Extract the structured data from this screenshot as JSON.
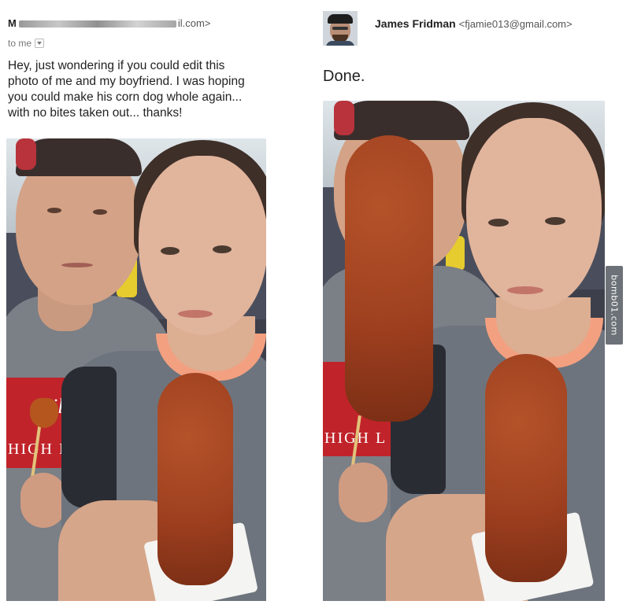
{
  "request_email": {
    "sender_initial": "M",
    "sender_suffix": "il.com>",
    "recipient": "to me",
    "body": "Hey, just wondering if you could edit this\nphoto of me and my boyfriend. I was hoping\nyou could make his corn dog whole again...\nwith no bites taken out... thanks!"
  },
  "reply_email": {
    "sender_name": "James Fridman",
    "sender_email": "<fjamie013@gmail.com>",
    "body": "Done."
  },
  "shirt_text": {
    "brand_fragment": "ill",
    "slogan_fragment_left": "HIGH L",
    "slogan_fragment_right": "HIGH L"
  },
  "watermark": "bomb01.com",
  "colors": {
    "corndog": "#9e3f1f",
    "shirt": "#7b7f86",
    "shirt_red": "#c0242a",
    "background": "#ffffff"
  }
}
